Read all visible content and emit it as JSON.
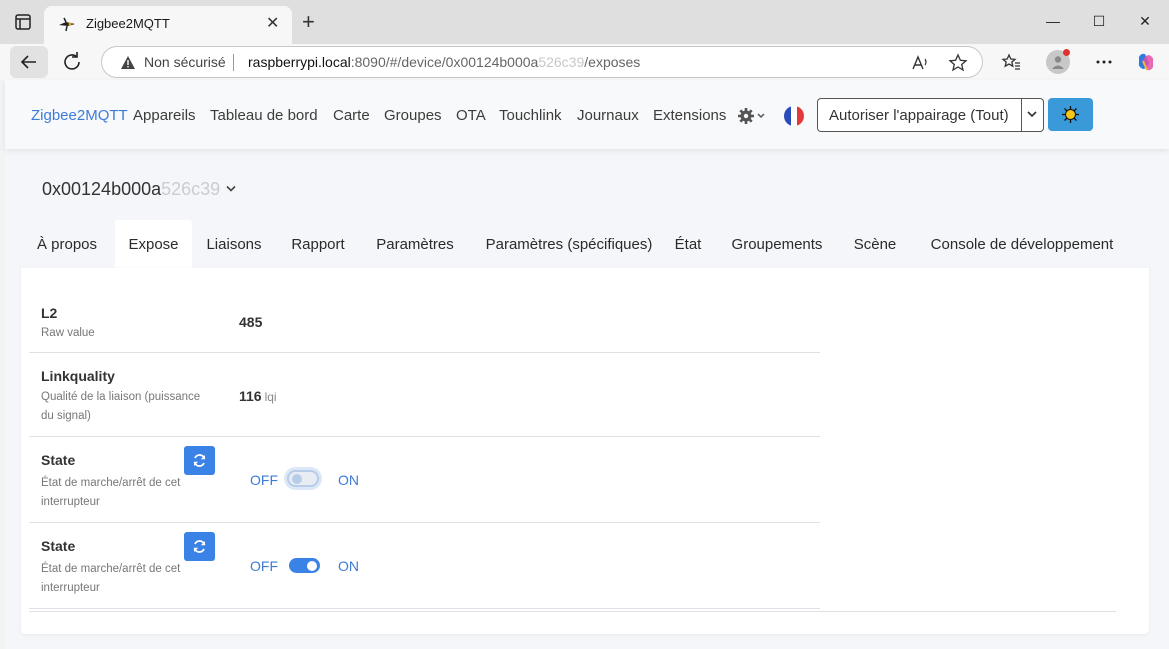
{
  "browser": {
    "tab_title": "Zigbee2MQTT",
    "tab_close": "✕",
    "new_tab": "+",
    "insecure_label": "Non sécurisé",
    "url_host": "raspberrypi.local",
    "url_rest": ":8090/#/device/0x00124b000a",
    "url_blurred": "526c39",
    "url_tail": "/exposes",
    "window_minimize": "—",
    "window_maximize": "☐",
    "window_close": "✕"
  },
  "app": {
    "brand": "Zigbee2MQTT",
    "nav": [
      "Appareils",
      "Tableau de bord",
      "Carte",
      "Groupes",
      "OTA",
      "Touchlink",
      "Journaux",
      "Extensions"
    ],
    "permit_join_label": "Autoriser l'appairage (Tout)"
  },
  "device": {
    "id_prefix": "0x00124b000a",
    "id_blurred": "526c39"
  },
  "tabs": [
    "À propos",
    "Expose",
    "Liaisons",
    "Rapport",
    "Paramètres",
    "Paramètres (spécifiques)",
    "État",
    "Groupements",
    "Scène",
    "Console de développement"
  ],
  "active_tab": "Expose",
  "exposes": [
    {
      "title": "L2",
      "description": "Raw value",
      "value": "485",
      "unit": ""
    },
    {
      "title": "Linkquality",
      "description": "Qualité de la liaison (puissance du signal)",
      "value": "116",
      "unit": "lqi"
    },
    {
      "title": "State",
      "description": "État de marche/arrêt de cet interrupteur",
      "off_label": "OFF",
      "on_label": "ON",
      "switch_state": "off"
    },
    {
      "title": "State",
      "description": "État de marche/arrêt de cet interrupteur",
      "off_label": "OFF",
      "on_label": "ON",
      "switch_state": "on"
    }
  ],
  "colors": {
    "accent": "#3e7bd6",
    "button_primary": "#3a82e6",
    "theme_button": "#3a9ad9"
  }
}
